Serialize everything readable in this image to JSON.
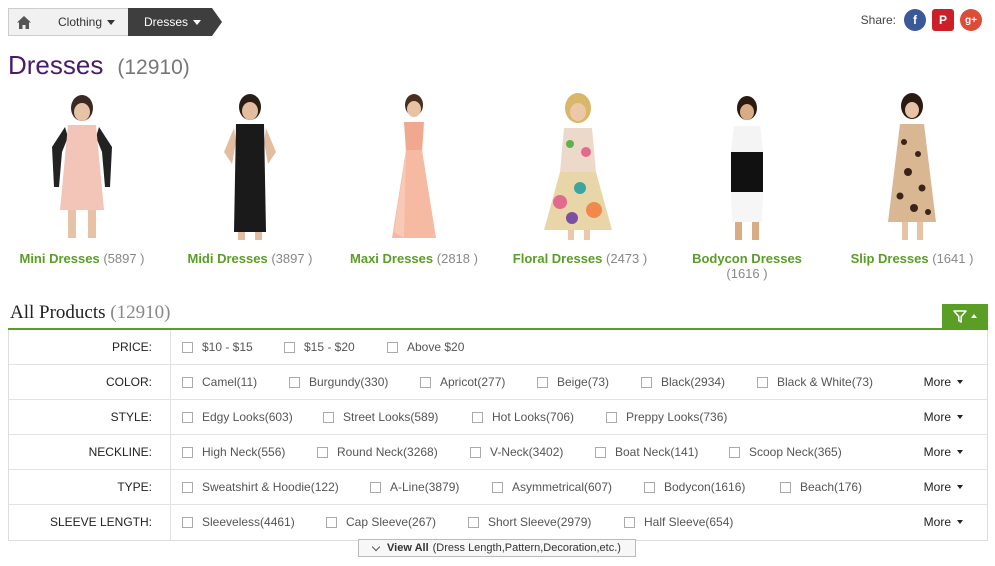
{
  "breadcrumb": {
    "home_icon": "home-icon",
    "items": [
      {
        "label": "Clothing"
      },
      {
        "label": "Dresses"
      }
    ]
  },
  "share": {
    "label": "Share:",
    "networks": [
      {
        "name": "facebook",
        "glyph": "f",
        "color": "#3b5998"
      },
      {
        "name": "pinterest",
        "glyph": "P",
        "color": "#cb2027"
      },
      {
        "name": "google-plus",
        "glyph": "g+",
        "color": "#dd4b39"
      }
    ]
  },
  "page": {
    "title": "Dresses",
    "count": "(12910)"
  },
  "categories": [
    {
      "label": "Mini Dresses",
      "count": "(5897 )",
      "image": "pink-mini-dress"
    },
    {
      "label": "Midi Dresses",
      "count": "(3897 )",
      "image": "black-midi-dress"
    },
    {
      "label": "Maxi Dresses",
      "count": "(2818 )",
      "image": "peach-maxi-dress"
    },
    {
      "label": "Floral Dresses",
      "count": "(2473 )",
      "image": "floral-dress"
    },
    {
      "label": "Bodycon Dresses",
      "count": "(1616 )",
      "image": "black-white-bodycon-dress"
    },
    {
      "label": "Slip Dresses",
      "count": "(1641 )",
      "image": "leopard-slip-dress"
    }
  ],
  "all_products": {
    "title": "All Products",
    "count": "(12910)"
  },
  "filters": [
    {
      "label": "PRICE:",
      "options": [
        "$10 - $15",
        "$15 - $20",
        "Above $20"
      ],
      "more": ""
    },
    {
      "label": "COLOR:",
      "options": [
        "Camel(11)",
        "Burgundy(330)",
        "Apricot(277)",
        "Beige(73)",
        "Black(2934)",
        "Black & White(73)"
      ],
      "more": "More"
    },
    {
      "label": "STYLE:",
      "options": [
        "Edgy Looks(603)",
        "Street Looks(589)",
        "Hot Looks(706)",
        "Preppy Looks(736)"
      ],
      "more": "More"
    },
    {
      "label": "NECKLINE:",
      "options": [
        "High Neck(556)",
        "Round Neck(3268)",
        "V-Neck(3402)",
        "Boat Neck(141)",
        "Scoop Neck(365)"
      ],
      "more": "More"
    },
    {
      "label": "TYPE:",
      "options": [
        "Sweatshirt & Hoodie(122)",
        "A-Line(3879)",
        "Asymmetrical(607)",
        "Bodycon(1616)",
        "Beach(176)"
      ],
      "more": "More"
    },
    {
      "label": "SLEEVE LENGTH:",
      "options": [
        "Sleeveless(4461)",
        "Cap Sleeve(267)",
        "Short Sleeve(2979)",
        "Half Sleeve(654)"
      ],
      "more": "More"
    }
  ],
  "view_all": {
    "bold": "View All",
    "rest": "(Dress Length,Pattern,Decoration,etc.)"
  }
}
